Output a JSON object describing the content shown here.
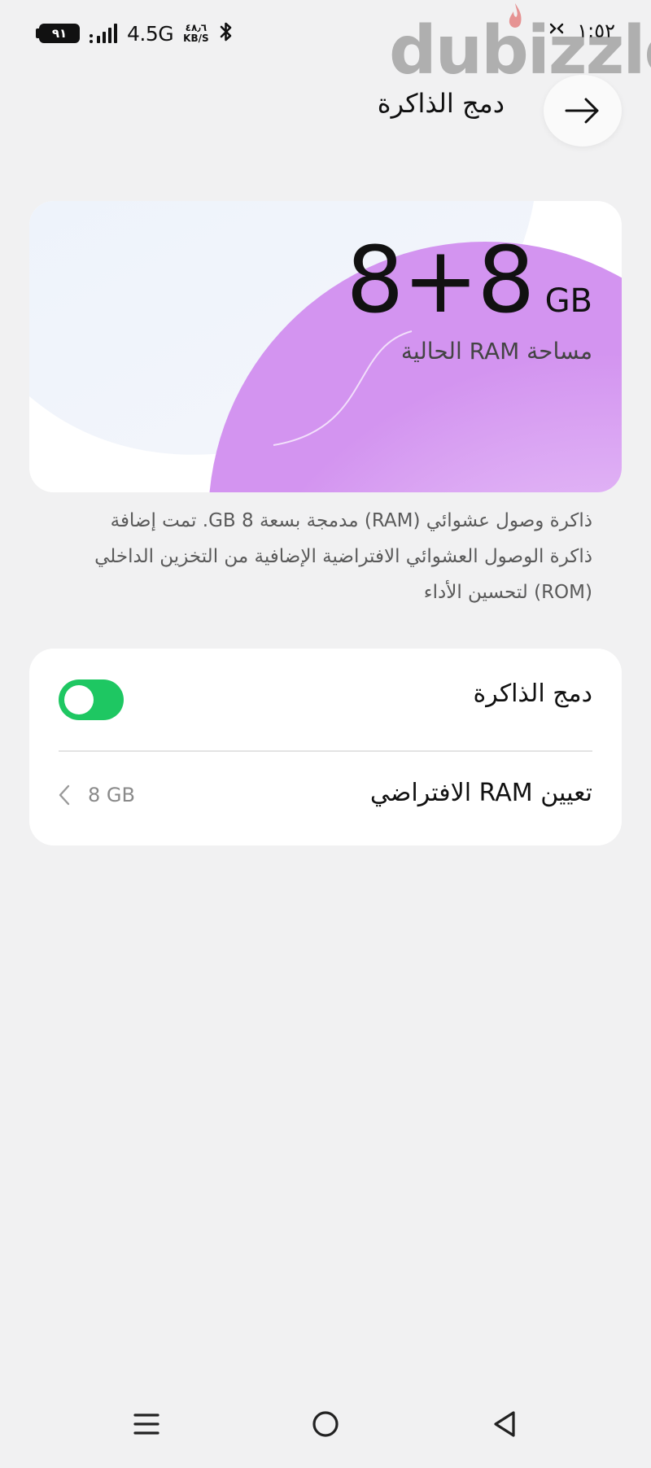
{
  "status_bar": {
    "battery_level": "٩١",
    "network_type": "4.5G",
    "speed_value": "٤٨٫٦",
    "speed_unit": "KB/S",
    "time": "١:٥٢",
    "icons": [
      "battery-icon",
      "signal-icon",
      "bluetooth-icon",
      "alarm-icon"
    ]
  },
  "watermark": {
    "text": "dubizzle"
  },
  "header": {
    "title": "دمج الذاكرة",
    "back_icon": "arrow-right-icon"
  },
  "ram_card": {
    "value": "8+8",
    "unit": "GB",
    "caption": "مساحة RAM الحالية"
  },
  "description": {
    "lines": [
      "ذاكرة وصول عشوائي (RAM) مدمجة بسعة 8 GB. تمت إضافة",
      "ذاكرة الوصول العشوائي الافتراضية الإضافية من التخزين الداخلي",
      "(ROM) لتحسين الأداء"
    ]
  },
  "settings": {
    "memory_merge_label": "دمج الذاكرة",
    "memory_merge_enabled": true,
    "virtual_ram_label": "تعيين RAM الافتراضي",
    "virtual_ram_value": "8 GB"
  },
  "nav_bar": {
    "icons": [
      "menu-icon",
      "home-icon",
      "back-icon"
    ]
  },
  "colors": {
    "toggle_on": "#1ec762",
    "page_background": "#f1f1f2",
    "card_background": "#ffffff",
    "accent_purple": "#d9a8f3"
  }
}
